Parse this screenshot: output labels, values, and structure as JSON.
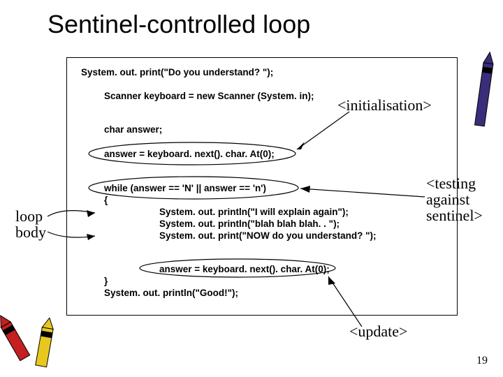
{
  "title": "Sentinel-controlled loop",
  "code": {
    "l1": "System. out. print(\"Do you understand? \");",
    "l2": "Scanner keyboard = new Scanner (System. in);",
    "l3": "char answer;",
    "l4": "answer = keyboard. next(). char. At(0);",
    "l5": "while (answer == 'N' || answer == 'n')",
    "l6": "{",
    "l7": "System. out. println(\"I will explain again\");",
    "l8": "System. out. println(\"blah blah blah. . \");",
    "l9": "System. out. print(\"NOW do you understand? \");",
    "l10": "answer = keyboard. next(). char. At(0);",
    "l11": "}",
    "l12": "System. out. println(\"Good!\");"
  },
  "tags": {
    "init": "<initialisation>",
    "test1": "<testing",
    "test2": "against",
    "test3": "sentinel>",
    "update": "<update>"
  },
  "labels": {
    "loop1": "loop",
    "loop2": "body"
  },
  "page": "19"
}
